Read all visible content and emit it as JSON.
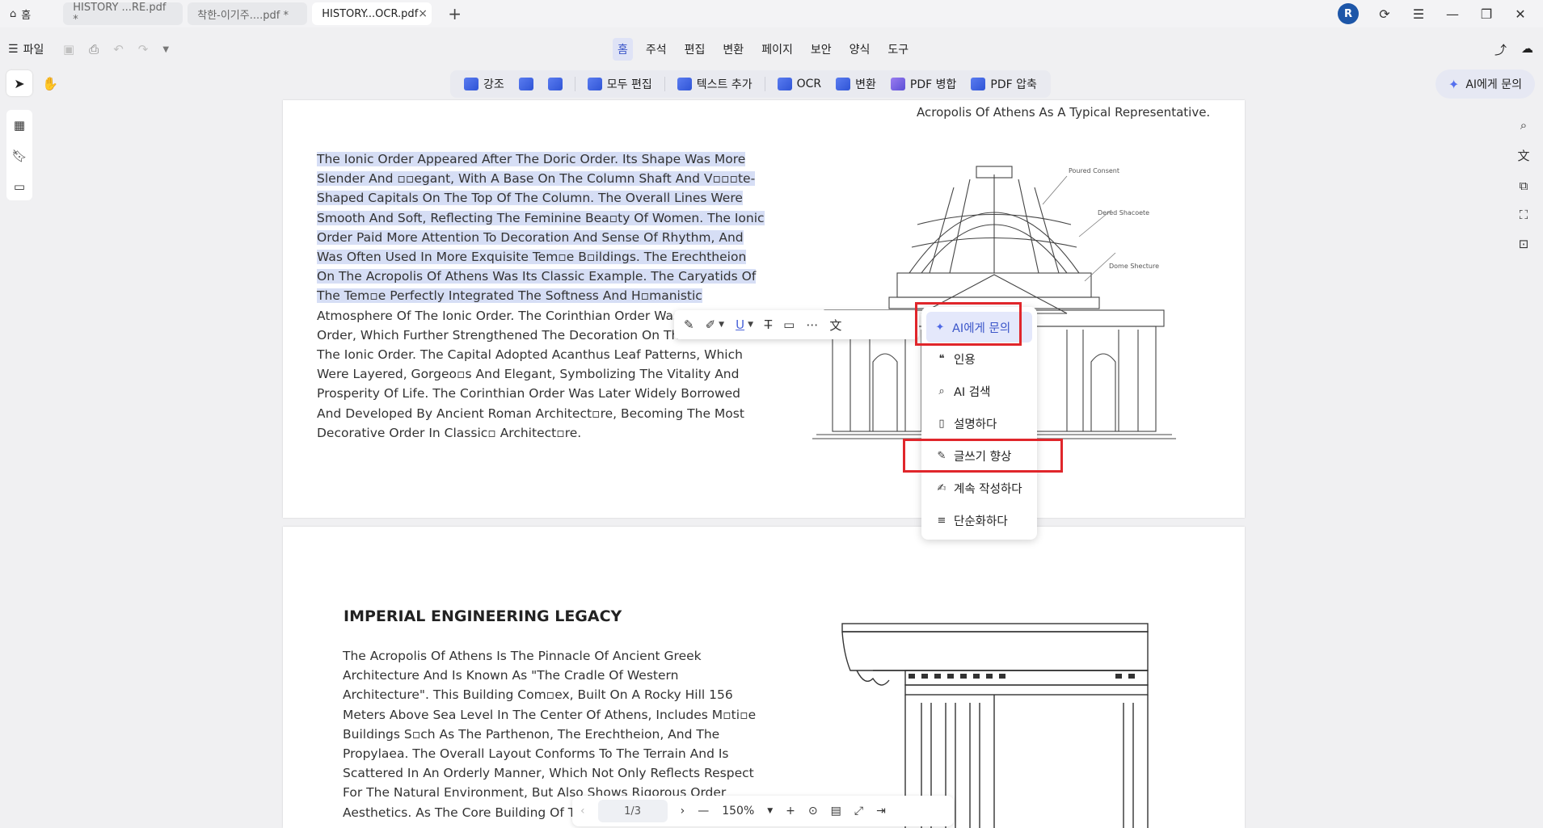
{
  "tabs": {
    "home_label": "홈",
    "items": [
      {
        "label": "HISTORY ...RE.pdf *"
      },
      {
        "label": "착한-이기주....pdf *"
      },
      {
        "label": "HISTORY...OCR.pdf"
      }
    ],
    "add_label": "+",
    "close_label": "×"
  },
  "user": {
    "initial": "R"
  },
  "file_menu": {
    "label": "파일"
  },
  "menus": [
    "홈",
    "주석",
    "편집",
    "변환",
    "페이지",
    "보안",
    "양식",
    "도구"
  ],
  "tools": [
    {
      "label": "강조"
    },
    {
      "label": ""
    },
    {
      "label": ""
    },
    {
      "label": "모두 편집"
    },
    {
      "label": "텍스트 추가"
    },
    {
      "label": "OCR"
    },
    {
      "label": "변환"
    },
    {
      "label": "PDF 병합"
    },
    {
      "label": "PDF 압축"
    }
  ],
  "ai_ask_label": "AI에게 문의",
  "doc": {
    "caption_top": "Acropolis Of Athens As A Typical Representative.",
    "para1_highlighted": [
      "The Ionic Order Appeared After The Doric Order. Its Shape Was More",
      "Slender And ▫▫egant, With A Base On The Column Shaft And V▫▫▫te-",
      "Shaped Capitals On The Top Of The Column. The Overall Lines Were",
      "Smooth And Soft, Reflecting The Feminine Bea▫ty Of Women. The Ionic",
      "Order Paid More Attention To Decoration And Sense Of Rhythm, And",
      "Was Often Used In More Exquisite Tem▫e B▫ildings. The Erechtheion",
      "On The Acropolis Of Athens Was Its Classic Example. The Caryatids Of",
      "The Tem▫e Perfectly Integrated The Softness And H▫manistic"
    ],
    "para1_plain": [
      "Atmosphere Of The Ionic Order. The Corinthian Order Was Th",
      "Order, Which Further Strengthened The Decoration On The Ba",
      "The Ionic Order. The Capital Adopted Acanthus Leaf Patterns, Which",
      "Were Layered, Gorgeo▫s And Elegant, Symbolizing The Vitality And",
      "Prosperity Of Life. The Corinthian Order Was Later Widely Borrowed",
      "And Developed By Ancient Roman Architect▫re, Becoming The Most",
      "Decorative Order In Classic▫ Architect▫re."
    ],
    "heading2": "IMPERIAL ENGINEERING LEGACY",
    "para2": [
      "The Acropolis Of Athens Is The Pinnacle Of Ancient Greek",
      "Architecture And Is Known As \"The Cradle Of Western",
      "Architecture\". This Building Com▫ex, Built On A Rocky Hill 156",
      "Meters Above Sea Level In The Center Of Athens, Includes M▫ti▫e",
      "Buildings S▫ch As The Parthenon, The Erechtheion, And The",
      "Propylaea. The Overall Layout Conforms To The Terrain And Is",
      "Scattered In An Orderly Manner, Which Not Only Reflects Respect",
      "For The Natural Environment, But Also Shows Rigorous Order",
      "Aesthetics. As The Core Building Of The"
    ],
    "illus_labels": [
      "Poured Consent",
      "Dered Shacoete",
      "Dome Shecture"
    ]
  },
  "ai_menu": {
    "items": [
      {
        "label": "AI에게 문의",
        "icon": "sparkle-icon"
      },
      {
        "label": "인용",
        "icon": "quote-icon"
      },
      {
        "label": "AI 검색",
        "icon": "search-icon"
      },
      {
        "label": "설명하다",
        "icon": "explain-icon"
      },
      {
        "label": "글쓰기 향상",
        "icon": "pen-icon"
      },
      {
        "label": "계속 작성하다",
        "icon": "continue-write-icon"
      },
      {
        "label": "단순화하다",
        "icon": "simplify-icon"
      }
    ]
  },
  "bottom_nav": {
    "page_indicator": "1/3",
    "zoom": "150%"
  },
  "colors": {
    "accent": "#3b56c9",
    "highlight": "#d6def5",
    "annotation_red": "#e0262b"
  }
}
